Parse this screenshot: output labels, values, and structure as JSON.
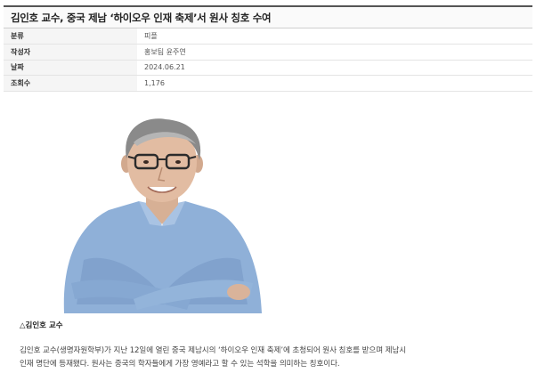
{
  "article": {
    "title": "김인호 교수, 중국 제남 ‘하이오우 인재 축제’서 원사 칭호 수여",
    "meta": [
      {
        "key": "분류",
        "value": "피플"
      },
      {
        "key": "작성자",
        "value": "홍보팀 윤주연"
      },
      {
        "key": "날짜",
        "value": "2024.06.21"
      },
      {
        "key": "조회수",
        "value": "1,176"
      }
    ],
    "photo_icon": "portrait-photo",
    "caption": "△김인호 교수",
    "body_lines": [
      "김인호 교수(생명자원학부)가 지난 12일에 열린 중국 제남시의 ‘하이오우 인재 축제’에 초청되어 원사 칭호를 받으며 제남시",
      "인재 명단에 등재됐다. 원사는 중국의 학자들에게 가장 영예라고 할 수 있는 석학을 의미하는 칭호이다."
    ]
  }
}
